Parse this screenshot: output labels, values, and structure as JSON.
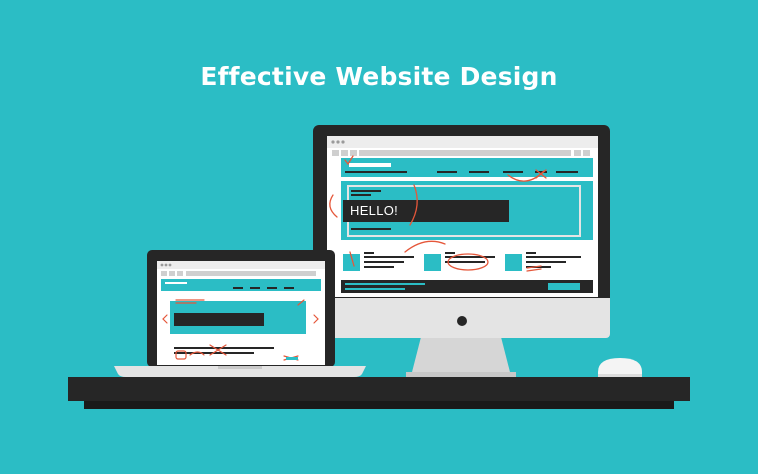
{
  "title": "Effective Website Design",
  "monitor": {
    "hero_text": "HELLO!"
  },
  "colors": {
    "background": "#2bbdc5",
    "accent_red": "#e5573a",
    "dark": "#262626",
    "light_gray": "#e4e4e4"
  },
  "icons": [
    "monitor-icon",
    "laptop-icon",
    "mouse-icon"
  ]
}
